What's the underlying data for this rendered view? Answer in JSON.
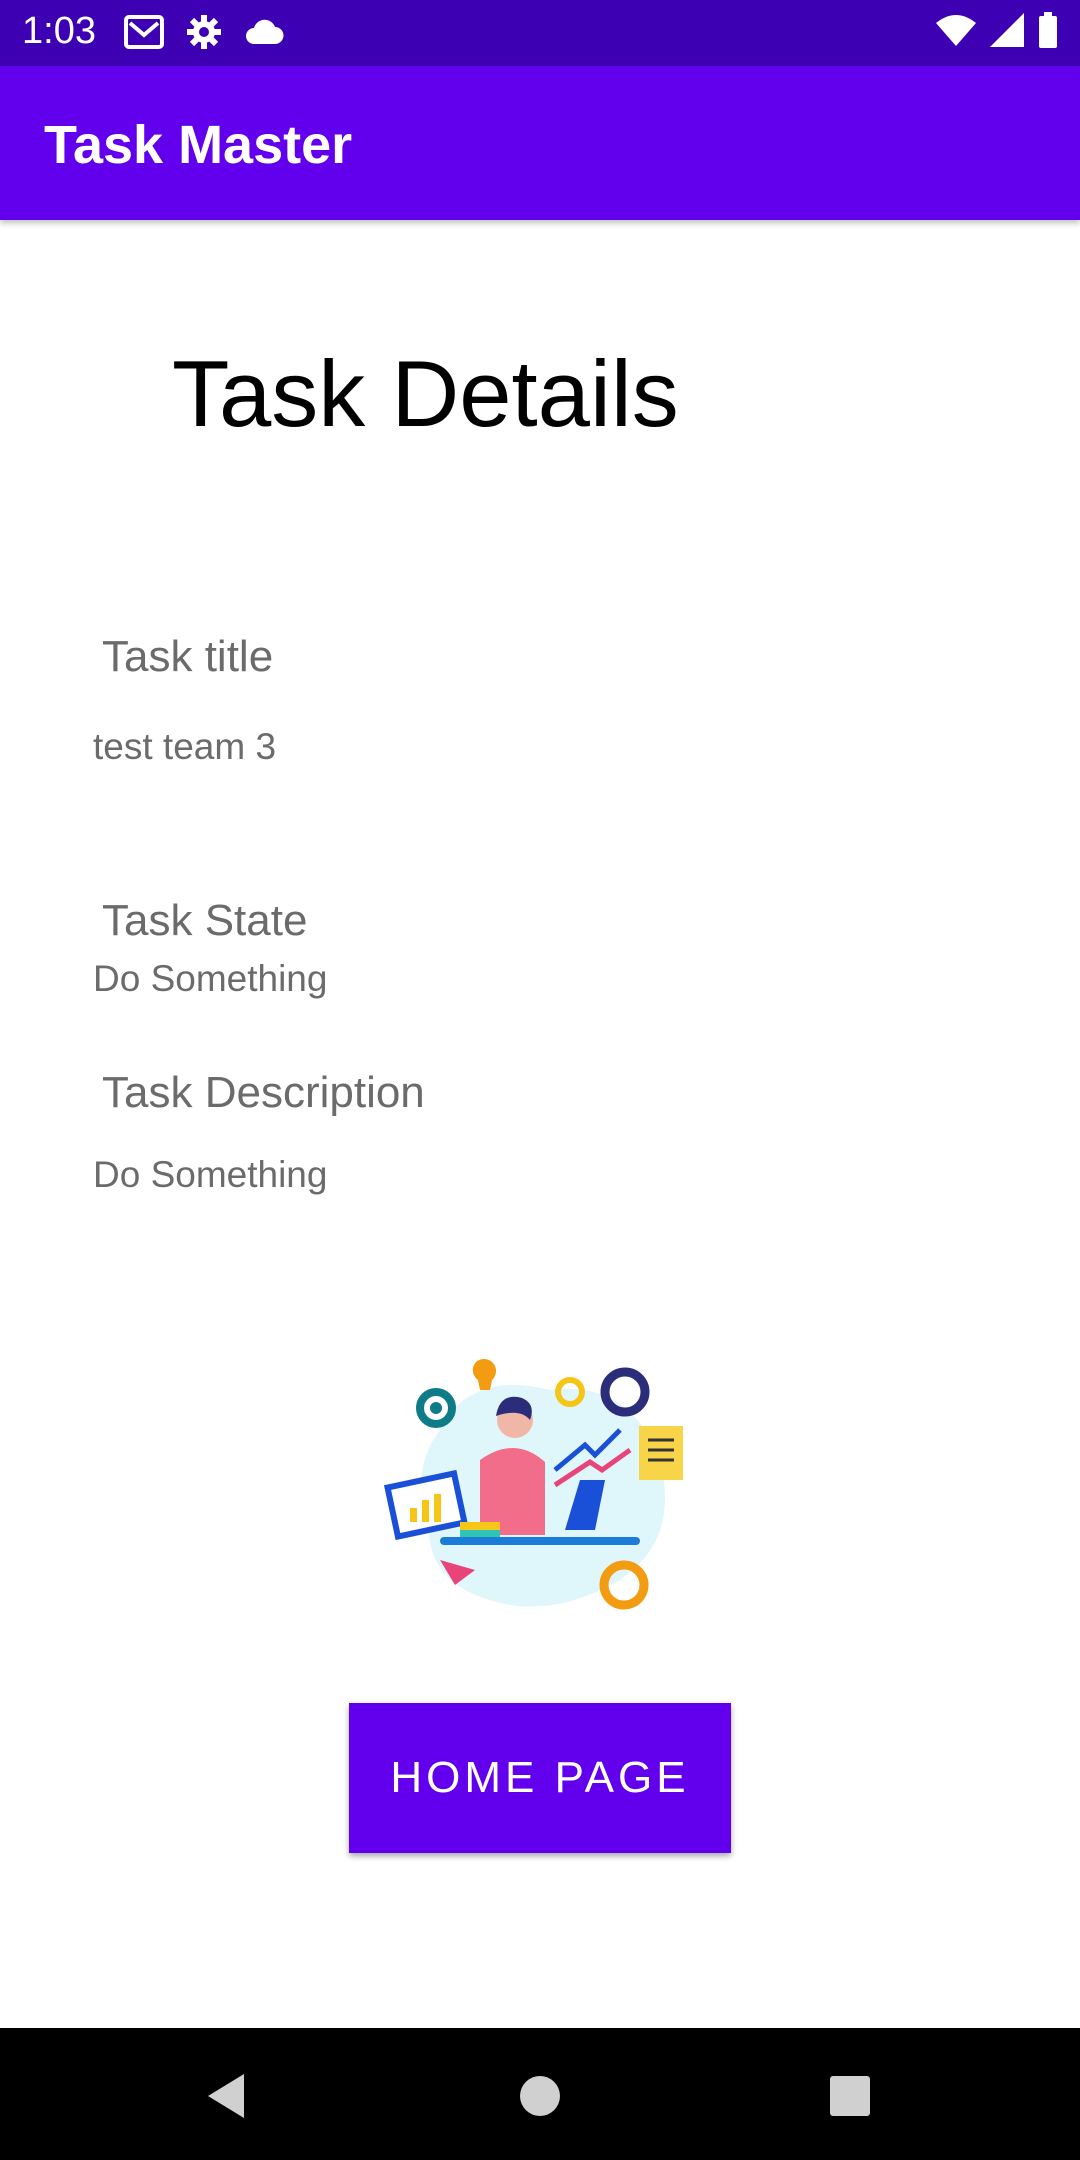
{
  "status_bar": {
    "time": "1:03",
    "left_icons": [
      "gmail-icon",
      "settings-icon",
      "cloud-icon"
    ],
    "right_icons": [
      "wifi-icon",
      "signal-icon",
      "battery-icon"
    ]
  },
  "app_bar": {
    "title": "Task Master"
  },
  "page": {
    "heading": "Task Details",
    "task_title_label": "Task title",
    "task_title_value": "test team 3",
    "task_state_label": "Task State",
    "task_state_value": "Do Something",
    "task_description_label": "Task Description",
    "task_description_value": "Do Something"
  },
  "home_button": {
    "label": "HOME PAGE"
  },
  "nav_bar": {
    "icons": [
      "back-icon",
      "home-icon",
      "recents-icon"
    ]
  },
  "colors": {
    "primary": "#6200ee",
    "status_bar": "#3d00b3",
    "text_secondary": "#6b6b6b"
  }
}
